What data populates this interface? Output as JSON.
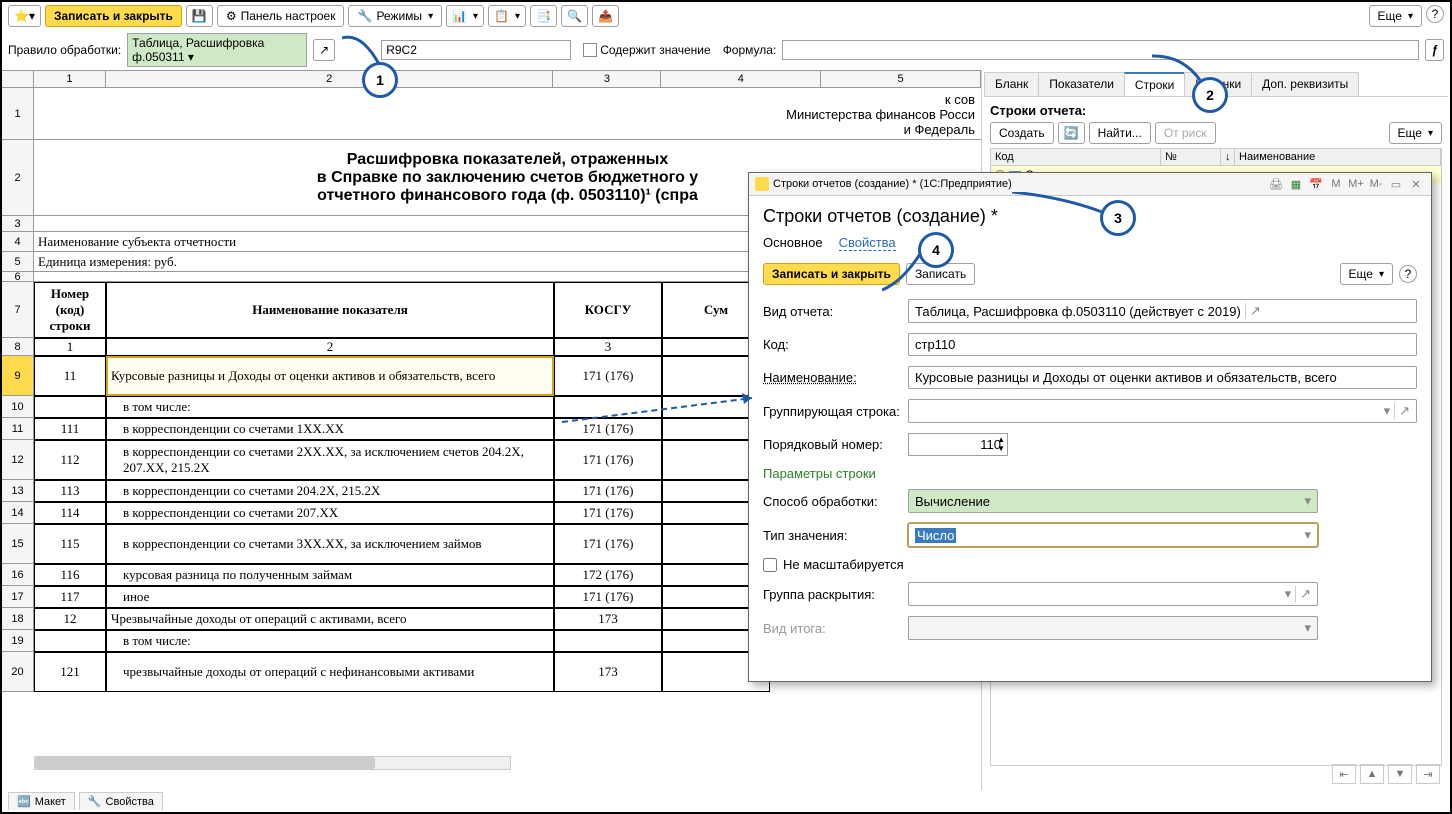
{
  "toolbar": {
    "save_close": "Записать и закрыть",
    "settings_panel": "Панель настроек",
    "modes": "Режимы",
    "more": "Еще"
  },
  "formula_bar": {
    "rule_label": "Правило обработки:",
    "rule_value": "Таблица, Расшифровка ф.050311",
    "cell_ref": "R9C2",
    "contains": "Содержит значение",
    "formula_label": "Формула:"
  },
  "sheet": {
    "col_nums": [
      "1",
      "2",
      "3",
      "4",
      "5"
    ],
    "header_lines": [
      "к сов",
      "Министерства финансов Росси",
      "и Федераль"
    ],
    "title1": "Расшифровка показателей, отраженных",
    "title2": "в Справке по заключению счетов бюджетного у",
    "title3": "отчетного финансового года (ф. 0503110)¹ (спра",
    "subject": "Наименование субъекта отчетности",
    "unit": "Единица измерения: руб.",
    "th1": "Номер (код) строки",
    "th2": "Наименование показателя",
    "th3": "КОСГУ",
    "th4": "Сум",
    "rows": [
      {
        "n": "1",
        "name": "",
        "k": "2",
        "s": "3"
      },
      {
        "n": "11",
        "name": "Курсовые разницы и Доходы от оценки активов и обязательств, всего",
        "k": "171 (176)",
        "s": ""
      },
      {
        "n": "",
        "name": "в том числе:",
        "k": "",
        "s": ""
      },
      {
        "n": "111",
        "name": "в корреспонденции со счетами 1ХХ.ХХ",
        "k": "171 (176)",
        "s": ""
      },
      {
        "n": "112",
        "name": "в корреспонденции со счетами 2ХХ.ХХ, за исключением счетов 204.2Х, 207.ХХ, 215.2Х",
        "k": "171 (176)",
        "s": ""
      },
      {
        "n": "113",
        "name": "в корреспонденции со счетами 204.2Х, 215.2Х",
        "k": "171 (176)",
        "s": ""
      },
      {
        "n": "114",
        "name": "в корреспонденции со счетами 207.ХХ",
        "k": "171 (176)",
        "s": ""
      },
      {
        "n": "115",
        "name": "в корреспонденции со счетами 3ХХ.ХХ, за исключением займов",
        "k": "171 (176)",
        "s": ""
      },
      {
        "n": "116",
        "name": "курсовая разница по полученным займам",
        "k": "172 (176)",
        "s": ""
      },
      {
        "n": "117",
        "name": "иное",
        "k": "171 (176)",
        "s": ""
      },
      {
        "n": "12",
        "name": "Чрезвычайные доходы от операций с активами, всего",
        "k": "173",
        "s": ""
      },
      {
        "n": "",
        "name": "в том числе:",
        "k": "",
        "s": ""
      },
      {
        "n": "121",
        "name": "чрезвычайные доходы от операций с нефинансовыми активами",
        "k": "173",
        "s": ""
      }
    ]
  },
  "right": {
    "tabs": [
      "Бланк",
      "Показатели",
      "Строки",
      "Колонки",
      "Доп. реквизиты"
    ],
    "section_title": "Строки отчета:",
    "create": "Создать",
    "find": "Найти...",
    "cancel_find": "От            риск",
    "more": "Еще",
    "th_code": "Код",
    "th_num": "№",
    "th_name": "Наименование",
    "row1": "Строки отчетов"
  },
  "dialog": {
    "win_title": "Строки отчетов (создание) * (1С:Предприятие)",
    "heading": "Строки отчетов (создание) *",
    "tab1": "Основное",
    "tab2": "Свойства",
    "save_close": "Записать и закрыть",
    "save": "Записать",
    "more": "Еще",
    "f_type_label": "Вид отчета:",
    "f_type_value": "Таблица, Расшифровка ф.0503110 (действует с 2019)",
    "f_code_label": "Код:",
    "f_code_value": "стр110",
    "f_name_label": "Наименование:",
    "f_name_value": "Курсовые разницы и Доходы от оценки активов и обязательств, всего",
    "f_group_label": "Группирующая строка:",
    "f_order_label": "Порядковый номер:",
    "f_order_value": "110",
    "params_title": "Параметры строки",
    "f_method_label": "Способ обработки:",
    "f_method_value": "Вычисление",
    "f_valtype_label": "Тип значения:",
    "f_valtype_value": "Число",
    "f_noscale": "Не масштабируется",
    "f_expand_label": "Группа раскрытия:",
    "f_total_label": "Вид итога:"
  },
  "bottom": {
    "tab1": "Макет",
    "tab2": "Свойства"
  },
  "callouts": {
    "c1": "1",
    "c2": "2",
    "c3": "3",
    "c4": "4"
  }
}
